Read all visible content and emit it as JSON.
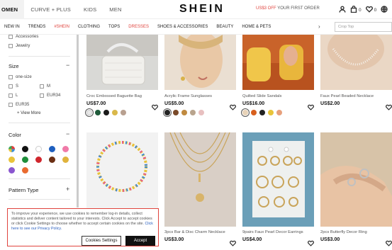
{
  "topbar": {
    "tabs": [
      "OMEN",
      "CURVE + PLUS",
      "KIDS",
      "MEN"
    ],
    "logo": "SHEIN",
    "promo_prefix": "US$3 OFF",
    "promo_suffix": "YOUR FIRST ORDER",
    "bag_count": "0",
    "wish_count": "0"
  },
  "nav": {
    "categories": [
      "NEW IN",
      "TRENDS",
      "#SHEIN",
      "CLOTHING",
      "TOPS",
      "DRESSES",
      "SHOES & ACCESSORIES",
      "BEAUTY",
      "HOME & PETS"
    ],
    "arrow": "›",
    "search_placeholder": "Crop Top"
  },
  "sidebar": {
    "filters_top": [
      "Accessories",
      "Jewelry"
    ],
    "size_title": "Size",
    "size_options": [
      "one-size",
      "S",
      "M",
      "L",
      "EUR34",
      "EUR35"
    ],
    "view_more": "+ View More",
    "color_title": "Color",
    "color_swatches": [
      "multi",
      "#111111",
      "#ffffff",
      "#1e5fbf",
      "#f07aa8",
      "#e9c33a",
      "#1e8e3a",
      "#d0262d",
      "#6b2f14",
      "#e0b33c",
      "#8a56cf",
      "#e96a2f"
    ],
    "pattern_title": "Pattern Type",
    "minus": "−",
    "plus": "+"
  },
  "cookie": {
    "text": "To improve your experience, we use cookies to remember log-in details, collect statistics and deliver content tailored to your interests. Click Accept to accept cookies or click Cookie Settings to choose whether to accept certain cookies on the site.",
    "link": "Click here to see our Privacy Policy.",
    "settings_label": "Cookies Settings",
    "accept_label": "Accept"
  },
  "products": [
    {
      "name": "Croc Embossed Baguette Bag",
      "price": "US$7.00",
      "colors": [
        "#e8e8e8",
        "#1f5a3a",
        "#1b1b1b",
        "#d9b84a",
        "#b8a090"
      ]
    },
    {
      "name": "Acrylic Frame Sunglasses",
      "price": "US$5.00",
      "colors": [
        "#222222",
        "#7a4a2a",
        "#c08a40",
        "#b9a48d",
        "#e8c0c0"
      ]
    },
    {
      "name": "Quilted Slide Sandals",
      "price": "US$16.00",
      "colors": [
        "#e8d3b8",
        "#d8601e",
        "#222222",
        "#e8c43a",
        "#e7a07c"
      ]
    },
    {
      "name": "Faux Pearl Beaded Necklace",
      "price": "US$2.00",
      "colors": []
    },
    {
      "name": "",
      "price": "",
      "colors": []
    },
    {
      "name": "3pcs Bar & Disc Charm Necklace",
      "price": "US$3.00",
      "colors": []
    },
    {
      "name": "9pairs Faux Pearl Decor Earrings",
      "price": "US$4.00",
      "colors": []
    },
    {
      "name": "2pcs Butterfly Decor Ring",
      "price": "US$3.00",
      "colors": []
    }
  ]
}
